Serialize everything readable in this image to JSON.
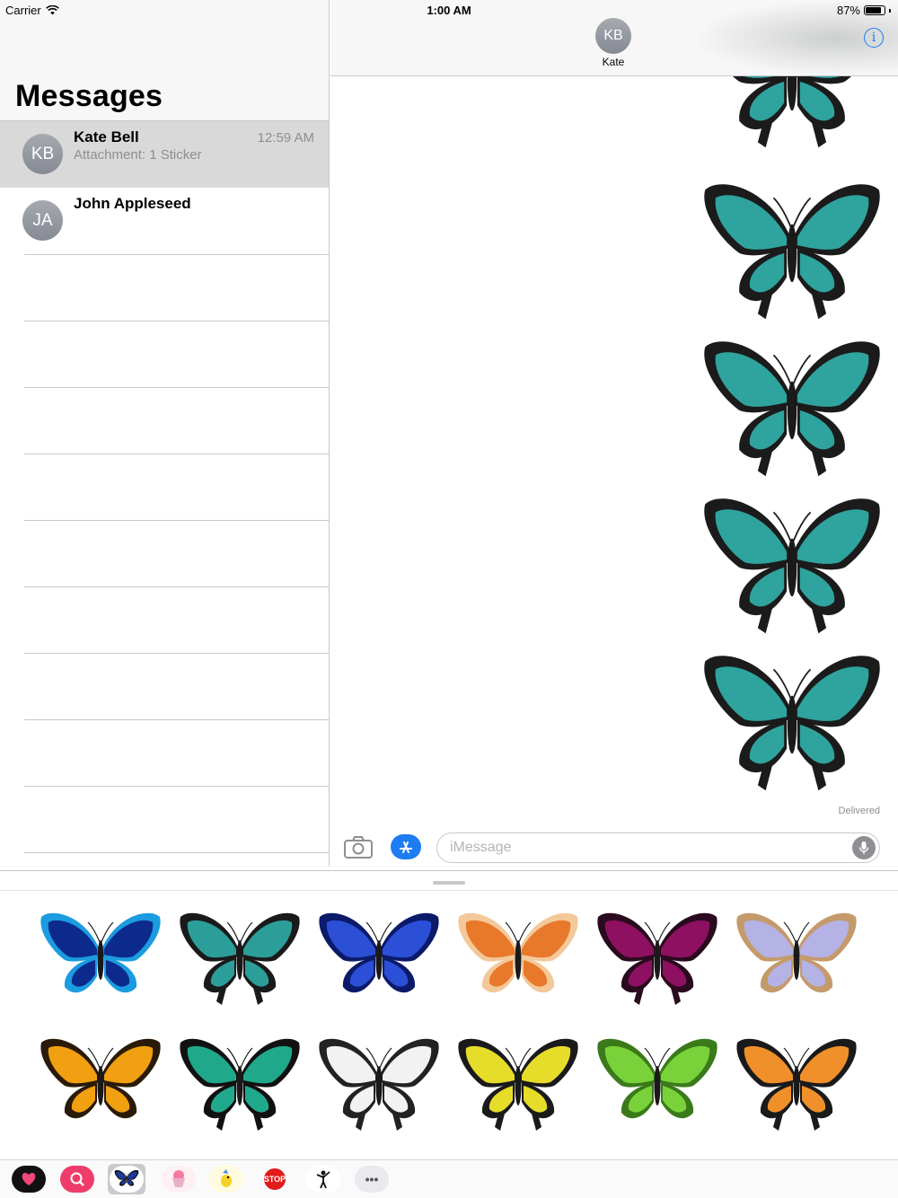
{
  "status_bar": {
    "carrier": "Carrier",
    "time": "1:00 AM",
    "battery": "87%",
    "battery_level": 0.87
  },
  "sidebar": {
    "title": "Messages",
    "conversations": [
      {
        "initials": "KB",
        "name": "Kate Bell",
        "preview": "Attachment: 1 Sticker",
        "time": "12:59 AM",
        "selected": true
      },
      {
        "initials": "JA",
        "name": "John Appleseed",
        "preview": "",
        "time": "",
        "selected": false
      }
    ]
  },
  "conversation": {
    "contact_initials": "KB",
    "contact_name": "Kate",
    "info_icon": "info-icon",
    "sticker_count": 5,
    "sticker_name": "teal-swallowtail-butterfly",
    "delivery_status": "Delivered"
  },
  "composer": {
    "camera_icon": "camera-icon",
    "apps_icon": "app-store-icon",
    "placeholder": "iMessage",
    "value": "",
    "mic_icon": "microphone-icon"
  },
  "sticker_drawer": {
    "stickers": [
      {
        "name": "blue-spotted-butterfly",
        "colors": [
          "#0c2a8c",
          "#1b9be0"
        ]
      },
      {
        "name": "teal-swallowtail-butterfly",
        "colors": [
          "#2b9e9a",
          "#1a1a1a"
        ]
      },
      {
        "name": "blue-morpho-butterfly",
        "colors": [
          "#2b4fd6",
          "#0c1a6a"
        ]
      },
      {
        "name": "orange-tortoiseshell-butterfly",
        "colors": [
          "#e8782a",
          "#f3c99a"
        ]
      },
      {
        "name": "magenta-swallowtail-butterfly",
        "colors": [
          "#8e1060",
          "#2a0a1e"
        ]
      },
      {
        "name": "lilac-butterfly",
        "colors": [
          "#b5b2e6",
          "#c49a6a"
        ]
      },
      {
        "name": "monarch-butterfly",
        "colors": [
          "#f0a010",
          "#2a1a08"
        ]
      },
      {
        "name": "green-ulysses-butterfly",
        "colors": [
          "#1fa98a",
          "#111111"
        ]
      },
      {
        "name": "white-swallowtail-butterfly",
        "colors": [
          "#f2f2f2",
          "#222222"
        ]
      },
      {
        "name": "yellow-swallowtail-butterfly",
        "colors": [
          "#e6dc2a",
          "#1a1a1a"
        ]
      },
      {
        "name": "green-birdwing-butterfly",
        "colors": [
          "#7ad23a",
          "#3a7a1a"
        ]
      },
      {
        "name": "orange-swallowtail-butterfly",
        "colors": [
          "#f0902a",
          "#1a1a1a"
        ]
      }
    ],
    "apps": [
      {
        "name": "heart-sticker-app-icon",
        "label": "",
        "bg": "#111111",
        "active": false
      },
      {
        "name": "image-search-app-icon",
        "label": "",
        "bg": "#f03c6a",
        "active": false
      },
      {
        "name": "butterfly-stickers-app-icon",
        "label": "",
        "bg": "#ffffff",
        "active": true
      },
      {
        "name": "dessert-app-icon",
        "label": "",
        "bg": "#fff0f4",
        "active": false
      },
      {
        "name": "party-bird-app-icon",
        "label": "",
        "bg": "#fffbe0",
        "active": false
      },
      {
        "name": "stop-sign-app-icon",
        "label": "STOP",
        "bg": "#e21b1b",
        "active": false
      },
      {
        "name": "dancer-app-icon",
        "label": "",
        "bg": "#ffffff",
        "active": false
      },
      {
        "name": "more-apps-icon",
        "label": "•••",
        "bg": "#e9e9ee",
        "active": false
      }
    ]
  }
}
